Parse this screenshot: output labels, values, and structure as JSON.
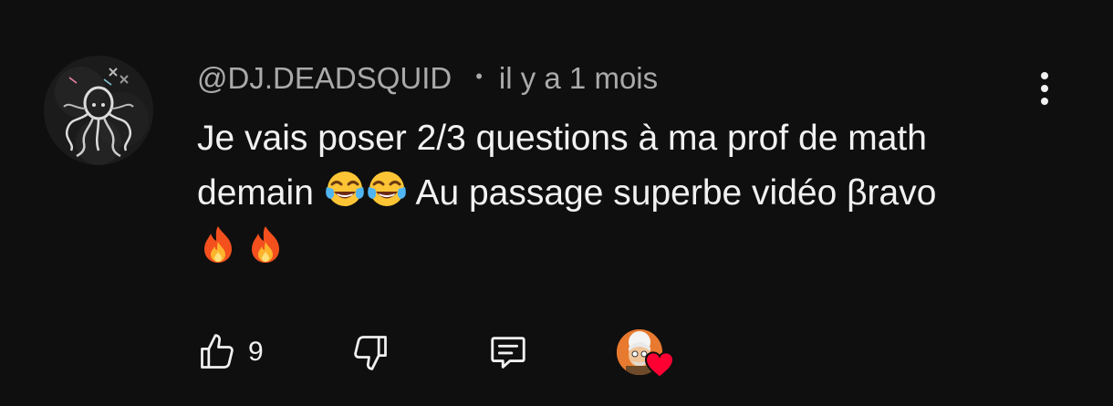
{
  "comment": {
    "author": "@DJ.DEADSQUID",
    "separator": "•",
    "time": "il y a 1 mois",
    "text_line1": "Je vais poser 2/3 questions à ma prof de math",
    "text_line2_before": "demain",
    "text_line2_after": "Au passage superbe vidéo βravo",
    "emojis": [
      "face-with-tears-of-joy",
      "face-with-tears-of-joy",
      "fire",
      "fire"
    ]
  },
  "actions": {
    "like_count": "9",
    "icons": {
      "like": "thumbs-up-icon",
      "dislike": "thumbs-down-icon",
      "reply": "comment-icon",
      "menu": "more-vertical-icon",
      "heart": "heart-icon"
    }
  },
  "colors": {
    "background": "#0f0f0f",
    "primary_text": "#f1f1f1",
    "secondary_text": "#aaaaaa",
    "heart": "#ff0033"
  }
}
